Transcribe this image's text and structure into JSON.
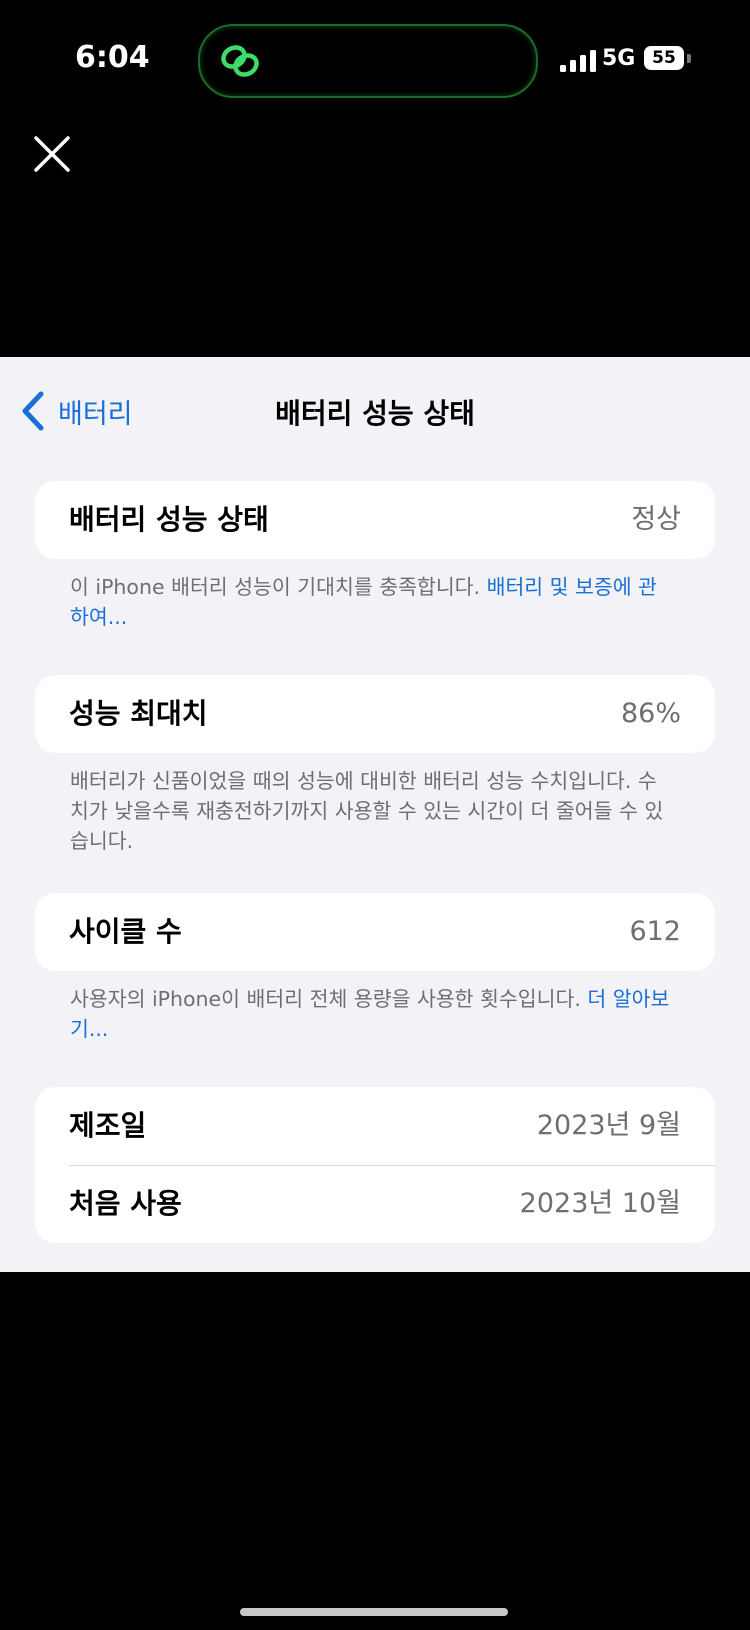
{
  "status_bar": {
    "time": "6:04",
    "network": "5G",
    "battery_level": "55"
  },
  "nav": {
    "back_label": "배터리",
    "title": "배터리 성능 상태"
  },
  "health": {
    "label": "배터리 성능 상태",
    "value": "정상",
    "note": "이 iPhone 배터리 성능이 기대치를 충족합니다. ",
    "link": "배터리 및 보증에 관하여..."
  },
  "max_capacity": {
    "label": "성능 최대치",
    "value": "86%",
    "note": "배터리가 신품이었을 때의 성능에 대비한 배터리 성능 수치입니다. 수치가 낮을수록 재충전하기까지 사용할 수 있는 시간이 더 줄어들 수 있습니다."
  },
  "cycle_count": {
    "label": "사이클 수",
    "value": "612",
    "note": "사용자의 iPhone이 배터리 전체 용량을 사용한 횟수입니다. ",
    "link": "더 알아보기..."
  },
  "dates": {
    "manufacture_label": "제조일",
    "manufacture_value": "2023년 9월",
    "first_use_label": "처음 사용",
    "first_use_value": "2023년 10월"
  },
  "colors": {
    "accent": "#1a6fd6",
    "sheet_bg": "#f2f2f7",
    "card_bg": "#ffffff",
    "secondary_text": "#6e6e73",
    "island_icon": "#3ddc6a"
  },
  "icons": {
    "close": "close-icon",
    "back": "chevron-left-icon",
    "island": "link-rings-icon",
    "signal": "cellular-signal-icon",
    "battery": "battery-icon"
  }
}
